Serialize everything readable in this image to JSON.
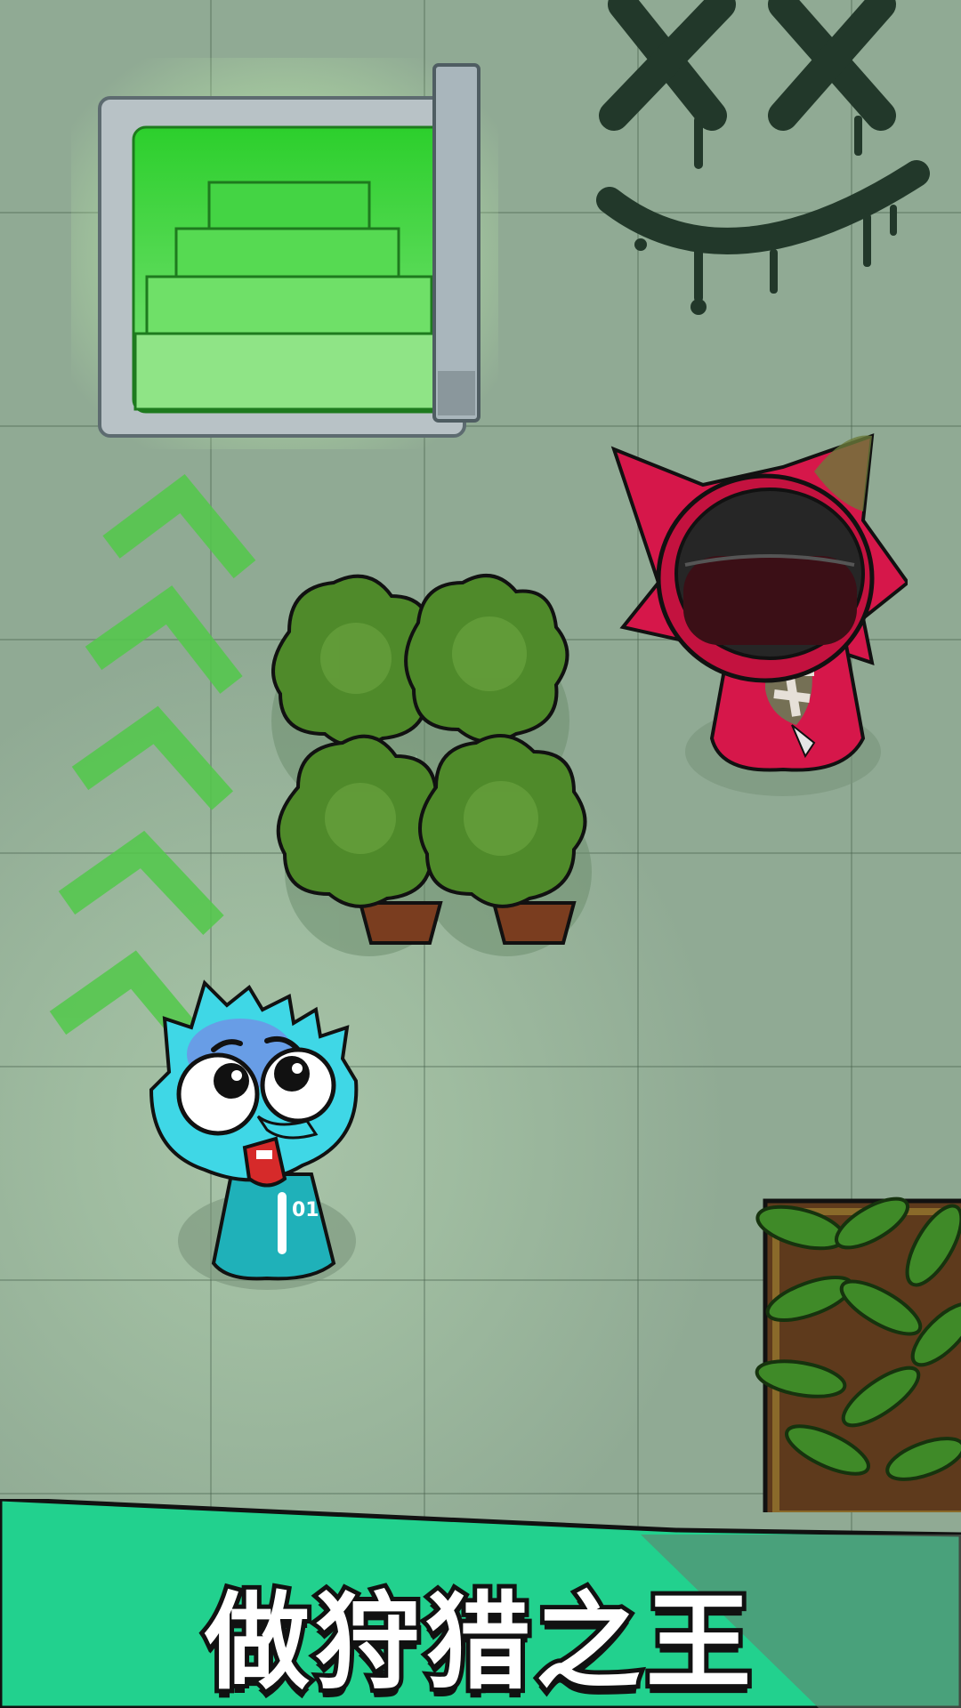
{
  "game": {
    "banner_text": "做狩猎之王",
    "player_number": "01"
  },
  "colors": {
    "banner": "#22d18e",
    "exit_glow": "#3fdc3f",
    "player": "#3fd7e6",
    "hunter": "#d6174a",
    "arrows": "#52c94a"
  },
  "icons": {
    "graffiti": "xx-smiley-icon",
    "arrows": "chevron-up-icon"
  }
}
